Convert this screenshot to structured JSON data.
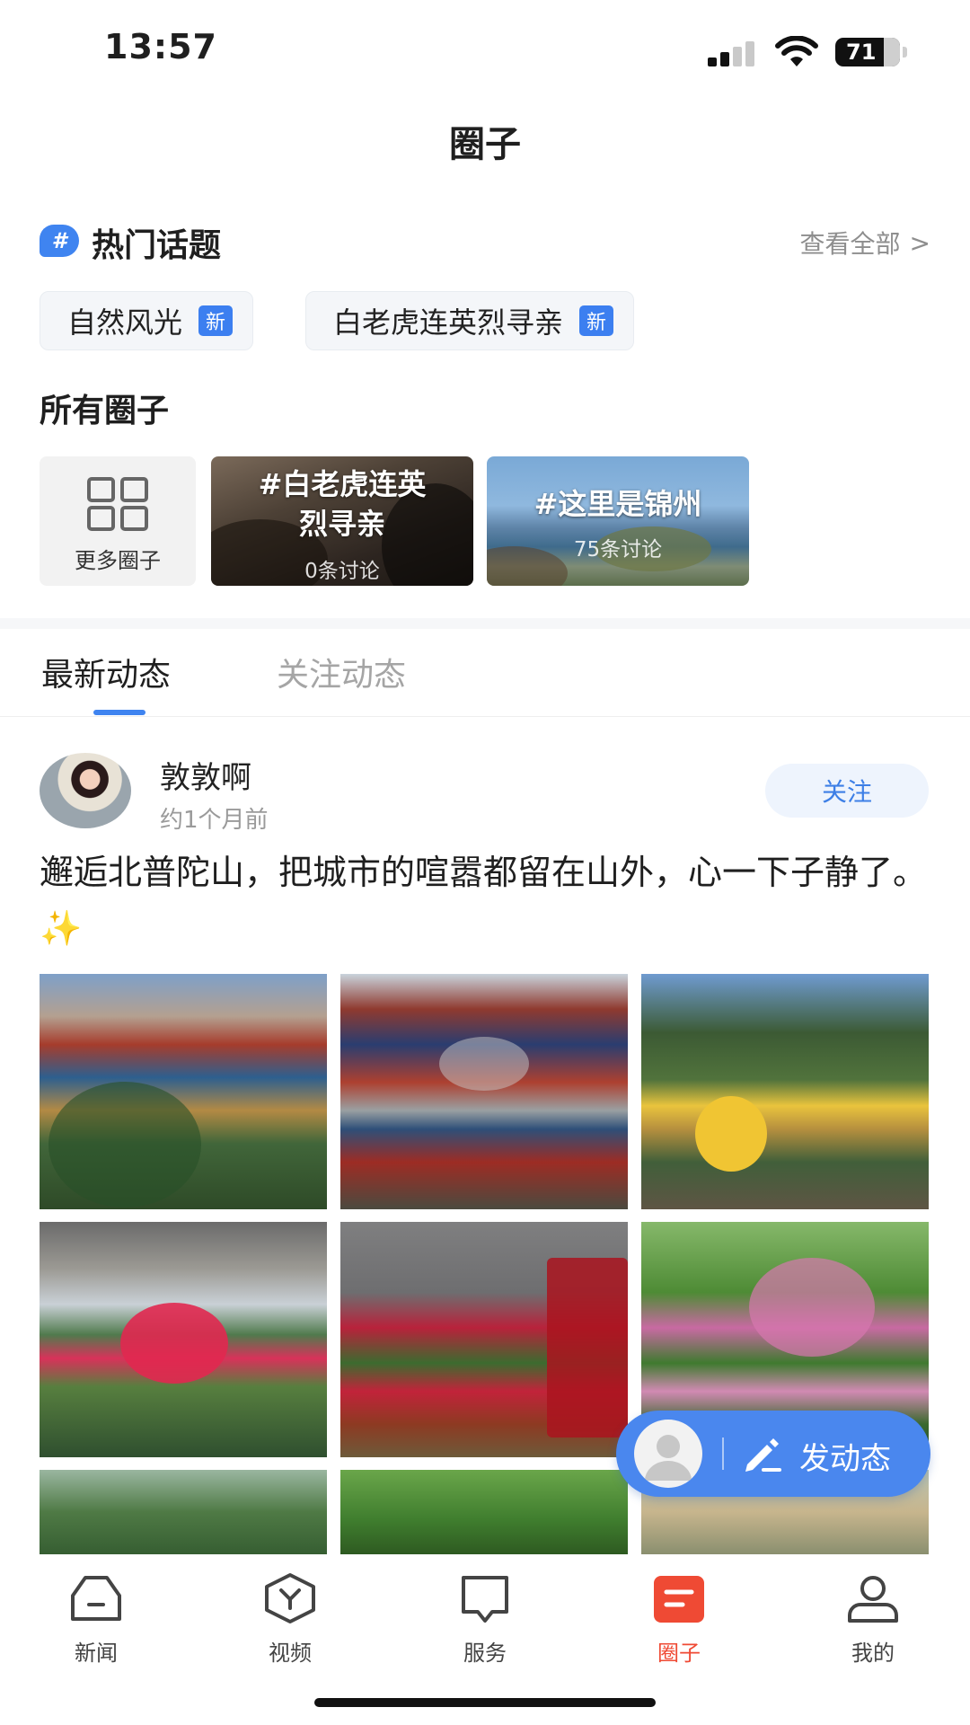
{
  "status_bar": {
    "time": "13:57",
    "battery": "71"
  },
  "page": {
    "title": "圈子"
  },
  "hot_topics": {
    "title": "热门话题",
    "view_all": "查看全部",
    "chevron": ">",
    "hash_symbol": "#",
    "items": [
      {
        "label": "自然风光",
        "badge": "新"
      },
      {
        "label": "白老虎连英烈寻亲",
        "badge": "新"
      }
    ]
  },
  "all_circles": {
    "title": "所有圈子",
    "more_label": "更多圈子",
    "cards": [
      {
        "name_line1": "#白老虎连英",
        "name_line2": "烈寻亲",
        "discussions": "0条讨论"
      },
      {
        "name": "#这里是锦州",
        "discussions": "75条讨论"
      }
    ]
  },
  "tabs": [
    {
      "label": "最新动态",
      "active": true
    },
    {
      "label": "关注动态",
      "active": false
    }
  ],
  "post": {
    "author": "敦敦啊",
    "time": "约1个月前",
    "follow_label": "关注",
    "text": "邂逅北普陀山，把城市的喧嚣都留在山外，心一下子静了。",
    "emoji": "✨",
    "photo_count": 9
  },
  "fab": {
    "label": "发动态"
  },
  "bottom_nav": [
    {
      "label": "新闻",
      "icon": "news-icon"
    },
    {
      "label": "视频",
      "icon": "video-icon"
    },
    {
      "label": "服务",
      "icon": "service-icon"
    },
    {
      "label": "圈子",
      "icon": "circle-icon",
      "active": true
    },
    {
      "label": "我的",
      "icon": "profile-icon"
    }
  ],
  "colors": {
    "accent_blue": "#3f84f0",
    "active_red": "#ef4a34",
    "muted_text": "#9a9a9a"
  }
}
